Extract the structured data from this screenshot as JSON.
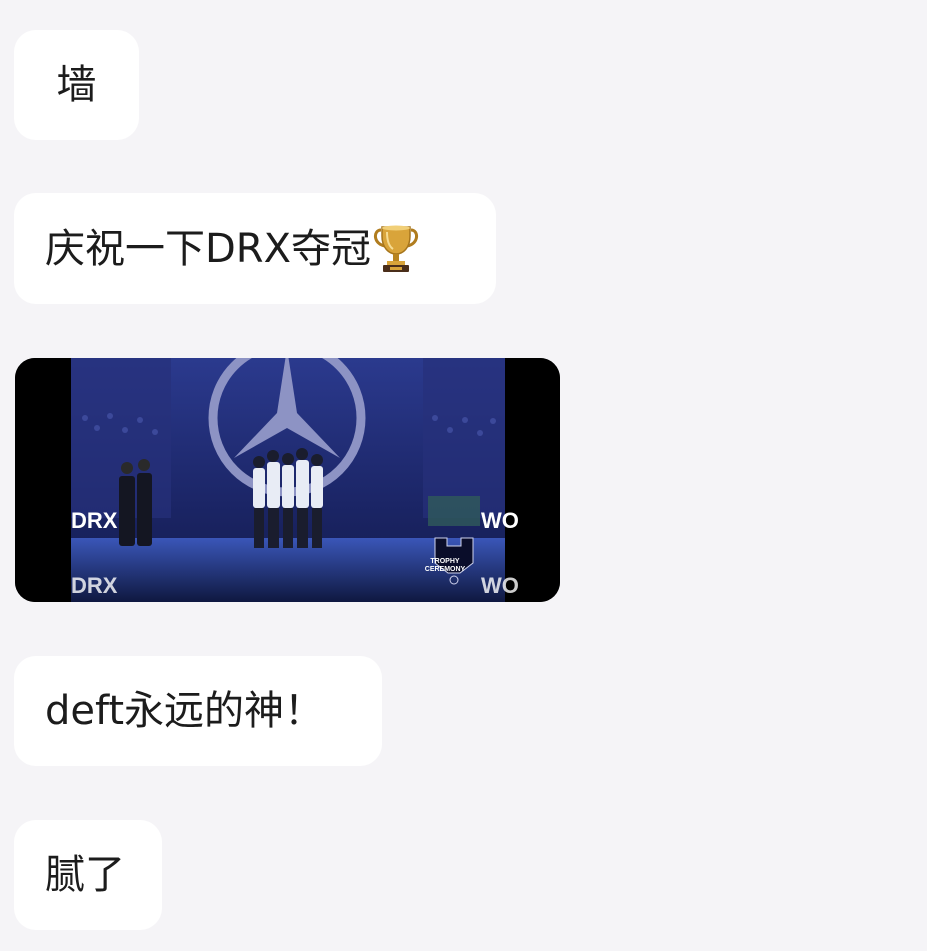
{
  "messages": [
    {
      "text": "墙"
    },
    {
      "text": "庆祝一下DRX夺冠",
      "emoji": "trophy"
    },
    {
      "type": "video",
      "overlay_brand": "TROPHY CEREMONY",
      "overlay_left": "DRX",
      "overlay_right": "WO"
    },
    {
      "text": "deft永远的神！"
    },
    {
      "text": "腻了"
    }
  ],
  "colors": {
    "background": "#f5f4f7",
    "bubble": "#ffffff",
    "text": "#1c1c1c",
    "trophy": "#d9a43a"
  }
}
